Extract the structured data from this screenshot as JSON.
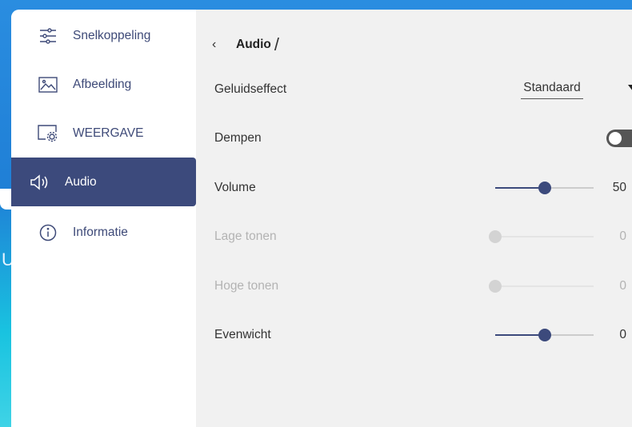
{
  "sidebar": {
    "items": [
      {
        "label": "Snelkoppeling",
        "icon": "sliders-icon",
        "active": false
      },
      {
        "label": "Afbeelding",
        "icon": "image-icon",
        "active": false
      },
      {
        "label": "WEERGAVE",
        "icon": "display-settings-icon",
        "active": false
      },
      {
        "label": "Audio",
        "icon": "speaker-icon",
        "active": true
      },
      {
        "label": "Informatie",
        "icon": "info-icon",
        "active": false
      }
    ]
  },
  "header": {
    "title": "Audio",
    "slash": "/"
  },
  "settings": {
    "sound_effect": {
      "label": "Geluidseffect",
      "value": "Standaard"
    },
    "mute": {
      "label": "Dempen",
      "on": false
    },
    "volume": {
      "label": "Volume",
      "value": "50",
      "level": 0.5,
      "enabled": true
    },
    "bass": {
      "label": "Lage tonen",
      "value": "0",
      "level": 0.0,
      "enabled": false
    },
    "treble": {
      "label": "Hoge tonen",
      "value": "0",
      "level": 0.0,
      "enabled": false
    },
    "balance": {
      "label": "Evenwicht",
      "value": "0",
      "level": 0.5,
      "enabled": true
    }
  },
  "colors": {
    "accent": "#3c4a7c",
    "content_bg": "#f1f1f1",
    "desktop_bg": "#1f7fd6"
  },
  "background_fragment": "U"
}
